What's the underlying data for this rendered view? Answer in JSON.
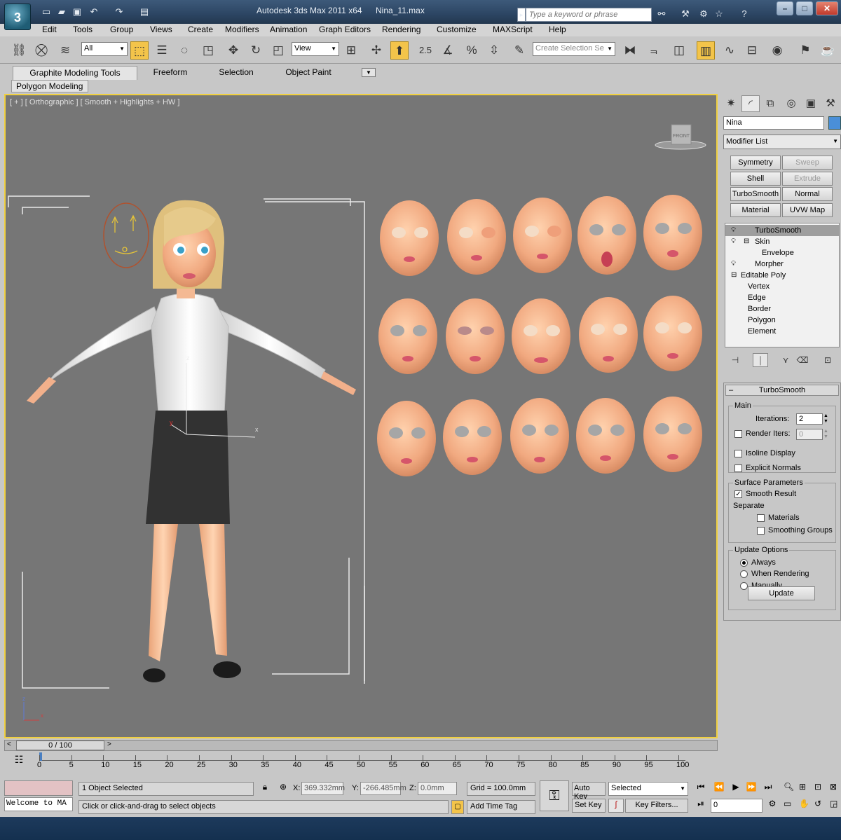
{
  "window": {
    "app_title": "Autodesk 3ds Max  2011 x64",
    "file_name": "Nina_11.max",
    "search_placeholder": "Type a keyword or phrase",
    "logo_text": "3"
  },
  "menu": [
    "Edit",
    "Tools",
    "Group",
    "Views",
    "Create",
    "Modifiers",
    "Animation",
    "Graph Editors",
    "Rendering",
    "Customize",
    "MAXScript",
    "Help"
  ],
  "toolbar": {
    "filter_value": "All",
    "reference_coord": "View",
    "selection_set_placeholder": "Create Selection Se",
    "snap_label": "2.5"
  },
  "ribbon": {
    "tabs": [
      "Graphite Modeling Tools",
      "Freeform",
      "Selection",
      "Object Paint"
    ],
    "sub_tab": "Polygon Modeling"
  },
  "viewport": {
    "label": "[ + ] [ Orthographic ] [ Smooth + Highlights + HW ]",
    "viewcube_face": "FRONT",
    "gizmo_axes": [
      "x",
      "y",
      "z"
    ]
  },
  "command_panel": {
    "object_name": "Nina",
    "object_color": "#4a8fd8",
    "modifier_list": "Modifier List",
    "modifier_buttons": [
      {
        "label": "Symmetry",
        "enabled": true
      },
      {
        "label": "Sweep",
        "enabled": false
      },
      {
        "label": "Shell",
        "enabled": true
      },
      {
        "label": "Extrude",
        "enabled": false
      },
      {
        "label": "TurboSmooth",
        "enabled": true
      },
      {
        "label": "Normal",
        "enabled": true
      },
      {
        "label": "Material",
        "enabled": true
      },
      {
        "label": "UVW Map",
        "enabled": true
      }
    ],
    "stack": [
      {
        "label": "TurboSmooth",
        "selected": true,
        "icon": "bulb-icon",
        "indent": 0
      },
      {
        "label": "Skin",
        "selected": false,
        "icon": "expand-icon",
        "indent": 0
      },
      {
        "label": "Envelope",
        "selected": false,
        "icon": "",
        "indent": 2
      },
      {
        "label": "Morpher",
        "selected": false,
        "icon": "bulb-icon",
        "indent": 0
      },
      {
        "label": "Editable Poly",
        "selected": false,
        "icon": "expand-icon",
        "indent": 0
      },
      {
        "label": "Vertex",
        "selected": false,
        "icon": "",
        "indent": 1
      },
      {
        "label": "Edge",
        "selected": false,
        "icon": "",
        "indent": 1
      },
      {
        "label": "Border",
        "selected": false,
        "icon": "",
        "indent": 1
      },
      {
        "label": "Polygon",
        "selected": false,
        "icon": "",
        "indent": 1
      },
      {
        "label": "Element",
        "selected": false,
        "icon": "",
        "indent": 1
      }
    ]
  },
  "turbosmooth": {
    "title": "TurboSmooth",
    "main_group": "Main",
    "iterations_label": "Iterations:",
    "iterations_value": "2",
    "render_iters_label": "Render Iters:",
    "render_iters_value": "0",
    "isoline_label": "Isoline Display",
    "explicit_normals_label": "Explicit Normals",
    "surface_group": "Surface Parameters",
    "smooth_result_label": "Smooth Result",
    "separate_label": "Separate",
    "materials_label": "Materials",
    "smoothing_groups_label": "Smoothing Groups",
    "update_group": "Update Options",
    "always_label": "Always",
    "when_rendering_label": "When Rendering",
    "manually_label": "Manually",
    "update_button": "Update"
  },
  "timeline": {
    "frame_display": "0 / 100",
    "ticks": [
      "0",
      "5",
      "10",
      "15",
      "20",
      "25",
      "30",
      "35",
      "40",
      "45",
      "50",
      "55",
      "60",
      "65",
      "70",
      "75",
      "80",
      "85",
      "90",
      "95",
      "100"
    ]
  },
  "status": {
    "script_listener": "Welcome to MA",
    "selection_count": "1 Object Selected",
    "prompt": "Click or click-and-drag to select objects",
    "x_label": "X:",
    "x_value": "369.332mm",
    "y_label": "Y:",
    "y_value": "-266.485mm",
    "z_label": "Z:",
    "z_value": "0.0mm",
    "grid": "Grid = 100.0mm",
    "add_time_tag": "Add Time Tag",
    "auto_key": "Auto Key",
    "set_key": "Set Key",
    "key_mode": "Selected",
    "key_filters": "Key Filters...",
    "current_frame": "0"
  }
}
